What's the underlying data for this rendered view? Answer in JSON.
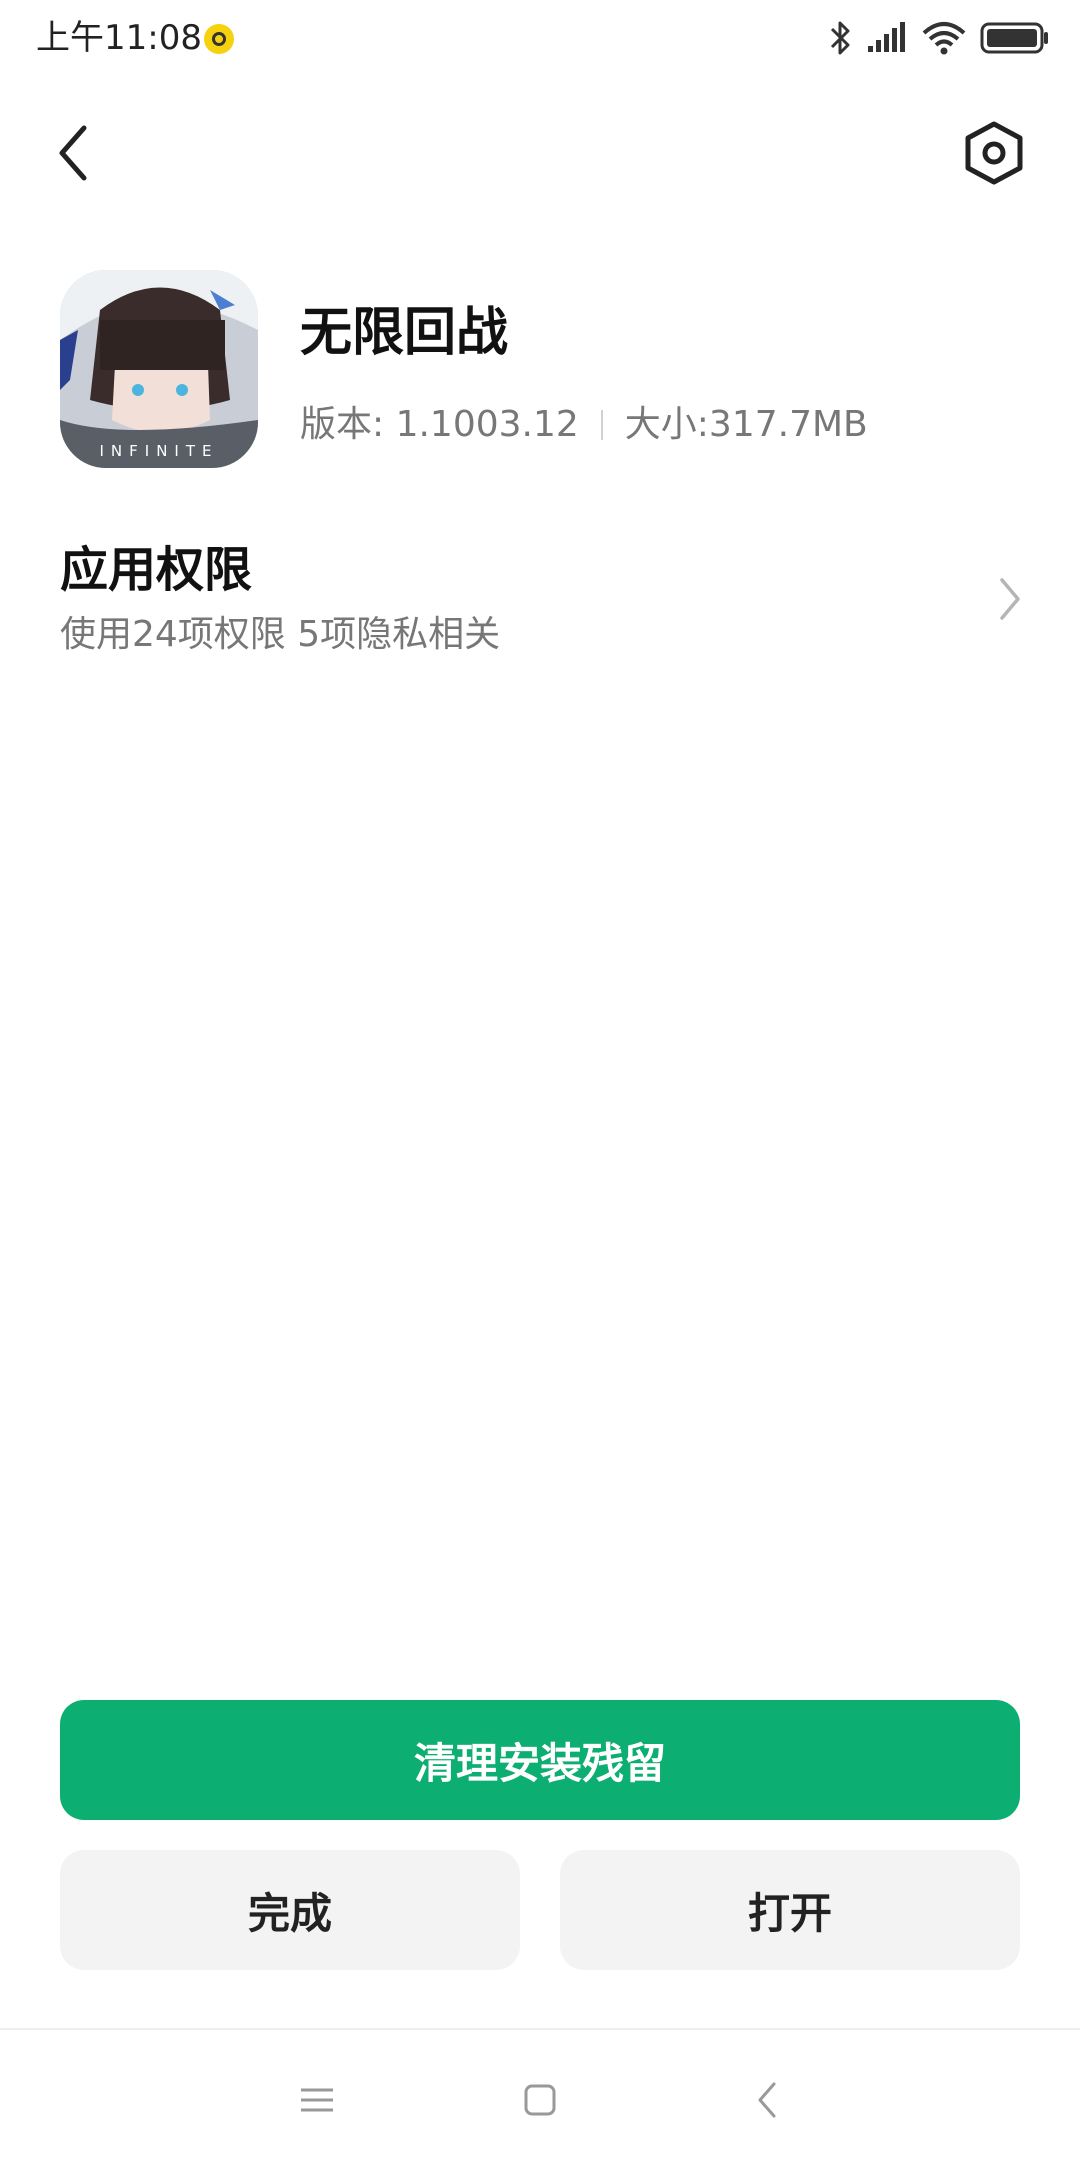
{
  "status_bar": {
    "time": "上午11:08",
    "icons": [
      "bluetooth-icon",
      "signal-icon",
      "wifi-icon",
      "battery-icon"
    ],
    "notification_dot_color": "#f6d10f"
  },
  "top_bar": {
    "back_icon": "back-arrow-icon",
    "settings_icon": "settings-hexagon-icon"
  },
  "app": {
    "name": "无限回战",
    "version_label": "版本: 1.1003.12",
    "size_label": "大小:317.7MB",
    "icon_text": "INFINITE"
  },
  "permissions": {
    "title": "应用权限",
    "subtitle": "使用24项权限 5项隐私相关"
  },
  "actions": {
    "primary_label": "清理安装残留",
    "done_label": "完成",
    "open_label": "打开",
    "primary_color": "#0cae72"
  },
  "nav_bar": {
    "items": [
      "menu-icon",
      "home-icon",
      "back-icon"
    ]
  }
}
